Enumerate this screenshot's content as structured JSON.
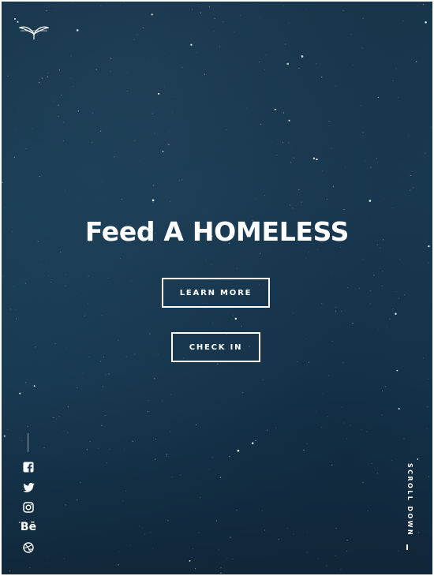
{
  "hero": {
    "title": "Feed A HOMELESS",
    "learn_more_label": "LEARN MORE",
    "check_in_label": "CHECK IN"
  },
  "social": {
    "items": [
      {
        "name": "facebook",
        "icon": "facebook-icon"
      },
      {
        "name": "twitter",
        "icon": "twitter-icon"
      },
      {
        "name": "instagram",
        "icon": "instagram-icon"
      },
      {
        "name": "behance",
        "icon": "behance-icon",
        "glyph": "Bē"
      },
      {
        "name": "dribbble",
        "icon": "dribbble-icon"
      }
    ]
  },
  "scroll": {
    "label": "SCROLL DOWN"
  },
  "colors": {
    "background_top": "#173549",
    "background_bottom": "#11283b",
    "foreground": "#ffffff"
  }
}
